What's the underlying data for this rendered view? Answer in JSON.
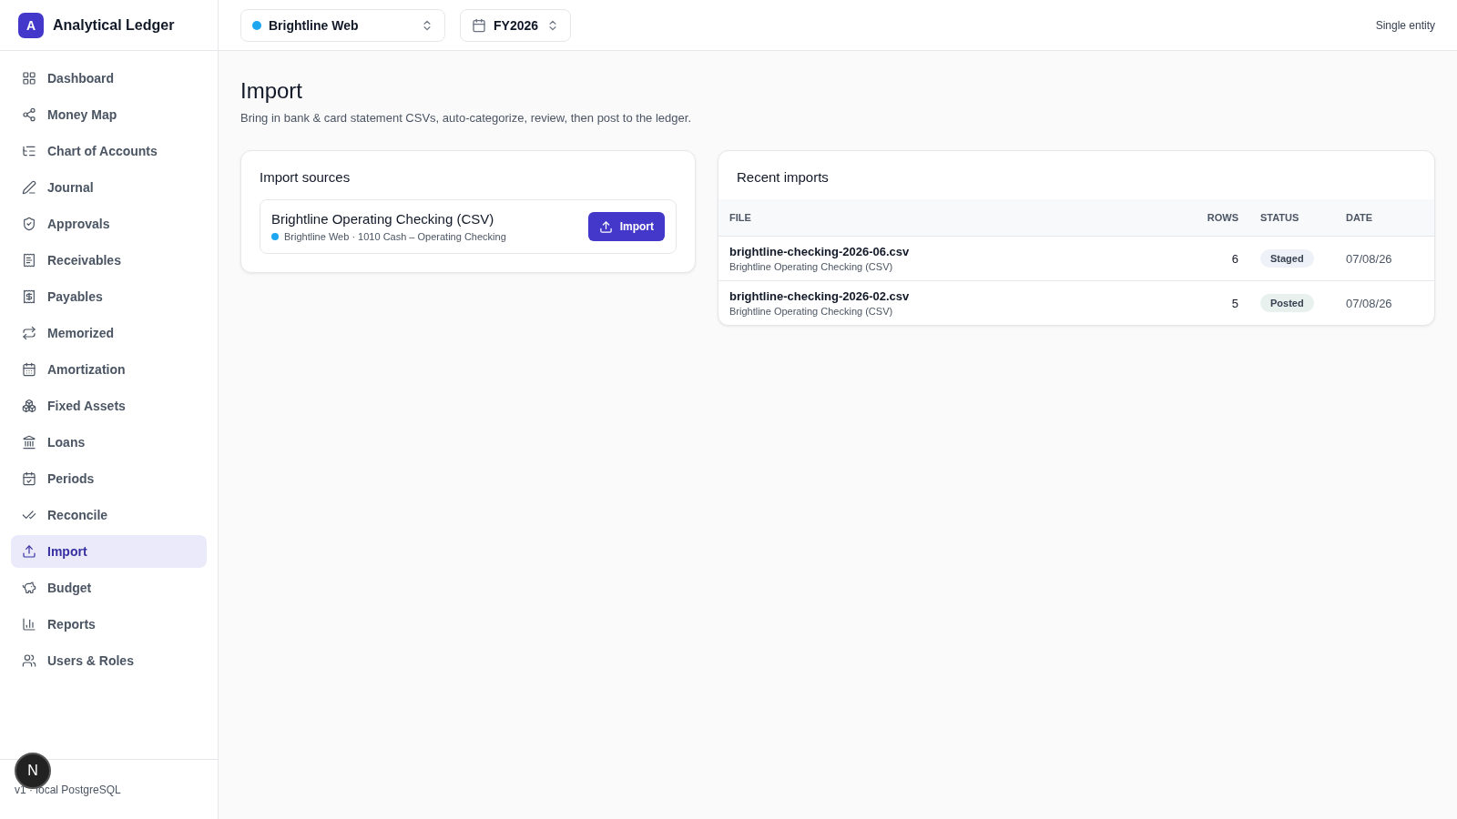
{
  "app": {
    "logo_letter": "A",
    "name": "Analytical Ledger"
  },
  "sidebar": {
    "items": [
      {
        "label": "Dashboard",
        "selected": false
      },
      {
        "label": "Money Map",
        "selected": false
      },
      {
        "label": "Chart of Accounts",
        "selected": false
      },
      {
        "label": "Journal",
        "selected": false
      },
      {
        "label": "Approvals",
        "selected": false
      },
      {
        "label": "Receivables",
        "selected": false
      },
      {
        "label": "Payables",
        "selected": false
      },
      {
        "label": "Memorized",
        "selected": false
      },
      {
        "label": "Amortization",
        "selected": false
      },
      {
        "label": "Fixed Assets",
        "selected": false
      },
      {
        "label": "Loans",
        "selected": false
      },
      {
        "label": "Periods",
        "selected": false
      },
      {
        "label": "Reconcile",
        "selected": false
      },
      {
        "label": "Import",
        "selected": true
      },
      {
        "label": "Budget",
        "selected": false
      },
      {
        "label": "Reports",
        "selected": false
      },
      {
        "label": "Users & Roles",
        "selected": false
      }
    ],
    "footer": "v1 · local PostgreSQL",
    "dev_badge": "N"
  },
  "topbar": {
    "entity": {
      "label": "Brightline Web",
      "color": "#1ea7f0"
    },
    "period": "FY2026",
    "mode": "Single entity"
  },
  "page": {
    "title": "Import",
    "subtitle": "Bring in bank & card statement CSVs, auto-categorize, review, then post to the ledger."
  },
  "import_sources": {
    "title": "Import sources",
    "sources": [
      {
        "name": "Brightline Operating Checking (CSV)",
        "detail": "Brightline Web · 1010 Cash – Operating Checking",
        "color": "#1ea7f0",
        "button": "Import"
      }
    ]
  },
  "recent_imports": {
    "title": "Recent imports",
    "columns": [
      "FILE",
      "ROWS",
      "STATUS",
      "DATE"
    ],
    "rows": [
      {
        "file": "brightline-checking-2026-06.csv",
        "source": "Brightline Operating Checking (CSV)",
        "rows": "6",
        "status": "Staged",
        "color": "#eef1f7",
        "date": "07/08/26"
      },
      {
        "file": "brightline-checking-2026-02.csv",
        "source": "Brightline Operating Checking (CSV)",
        "rows": "5",
        "status": "Posted",
        "color": "#e8f1ee",
        "date": "07/08/26"
      }
    ]
  }
}
